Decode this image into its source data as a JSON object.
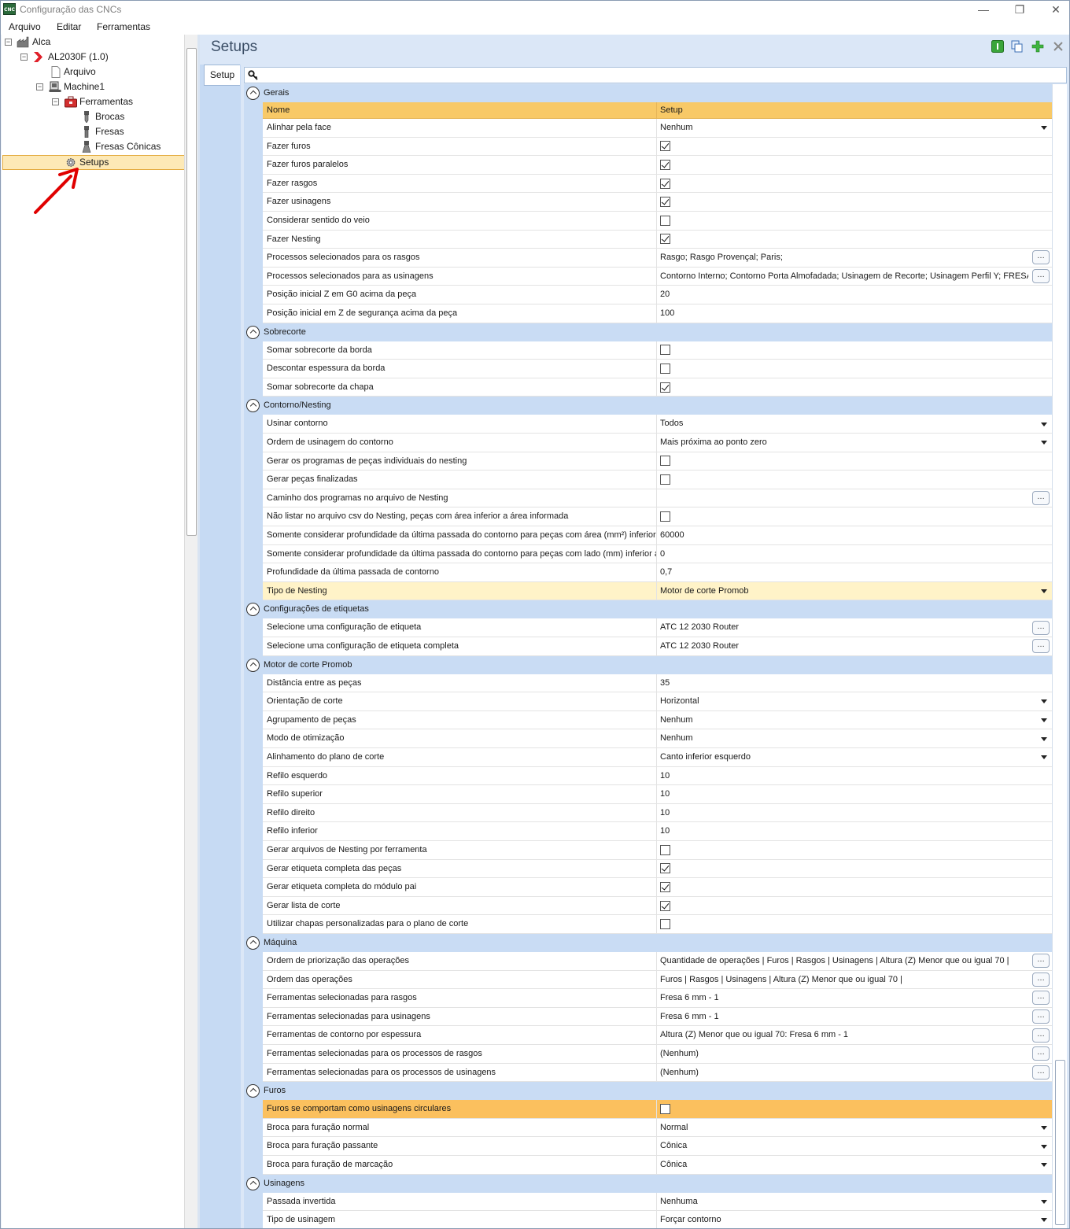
{
  "window": {
    "title": "Configuração das CNCs",
    "app_icon_text": "CNC",
    "minimize": "—",
    "restore": "❐",
    "close": "✕"
  },
  "menu": [
    "Arquivo",
    "Editar",
    "Ferramentas"
  ],
  "tree": {
    "root": "Alca",
    "machine_file": "AL2030F (1.0)",
    "arquivo": "Arquivo",
    "machine": "Machine1",
    "ferramentas": "Ferramentas",
    "brocas": "Brocas",
    "fresas": "Fresas",
    "fresas_conicas": "Fresas Cônicas",
    "setups": "Setups"
  },
  "page": {
    "title": "Setups",
    "tab": "Setup",
    "search_icon": "key-search-icon"
  },
  "grid": {
    "header": {
      "name": "Nome",
      "value": "Setup"
    },
    "rows": [
      {
        "kind": "group",
        "label": "Gerais"
      },
      {
        "kind": "header"
      },
      {
        "kind": "prop",
        "name": "Alinhar pela face",
        "type": "dropdown",
        "value": "Nenhum"
      },
      {
        "kind": "prop",
        "name": "Fazer furos",
        "type": "check",
        "checked": true
      },
      {
        "kind": "prop",
        "name": "Fazer furos paralelos",
        "type": "check",
        "checked": true
      },
      {
        "kind": "prop",
        "name": "Fazer rasgos",
        "type": "check",
        "checked": true
      },
      {
        "kind": "prop",
        "name": "Fazer usinagens",
        "type": "check",
        "checked": true
      },
      {
        "kind": "prop",
        "name": "Considerar sentido do veio",
        "type": "check",
        "checked": false
      },
      {
        "kind": "prop",
        "name": "Fazer Nesting",
        "type": "check",
        "checked": true
      },
      {
        "kind": "prop",
        "name": "Processos selecionados para os rasgos",
        "type": "ellipsis",
        "value": "Rasgo; Rasgo Provençal; Paris;"
      },
      {
        "kind": "prop",
        "name": "Processos selecionados para as usinagens",
        "type": "ellipsis",
        "value": "Contorno Interno; Contorno Porta Almofadada; Usinagem de Recorte; Usinagem Perfil Y; FRESADO"
      },
      {
        "kind": "prop",
        "name": "Posição inicial Z em G0 acima da peça",
        "type": "text",
        "value": "20"
      },
      {
        "kind": "prop",
        "name": "Posição inicial em Z de segurança acima da peça",
        "type": "text",
        "value": "100"
      },
      {
        "kind": "group",
        "label": "Sobrecorte"
      },
      {
        "kind": "prop",
        "name": "Somar sobrecorte da borda",
        "type": "check",
        "checked": false
      },
      {
        "kind": "prop",
        "name": "Descontar espessura da borda",
        "type": "check",
        "checked": false
      },
      {
        "kind": "prop",
        "name": "Somar sobrecorte da chapa",
        "type": "check",
        "checked": true
      },
      {
        "kind": "group",
        "label": "Contorno/Nesting"
      },
      {
        "kind": "prop",
        "name": "Usinar contorno",
        "type": "dropdown",
        "value": "Todos"
      },
      {
        "kind": "prop",
        "name": "Ordem de usinagem do contorno",
        "type": "dropdown",
        "value": "Mais próxima ao ponto zero"
      },
      {
        "kind": "prop",
        "name": "Gerar os programas de peças individuais do nesting",
        "type": "check",
        "checked": false
      },
      {
        "kind": "prop",
        "name": "Gerar peças finalizadas",
        "type": "check",
        "checked": false
      },
      {
        "kind": "prop",
        "name": "Caminho dos programas no arquivo de Nesting",
        "type": "ellipsis",
        "value": ""
      },
      {
        "kind": "prop",
        "name": "Não listar no arquivo csv do Nesting, peças com área inferior a área informada",
        "type": "check",
        "checked": false
      },
      {
        "kind": "prop",
        "name": "Somente considerar profundidade da última passada do contorno para peças com área (mm²) inferior",
        "type": "text",
        "value": "60000"
      },
      {
        "kind": "prop",
        "name": "Somente considerar profundidade da última passada do contorno para peças com lado (mm) inferior a",
        "type": "text",
        "value": "0"
      },
      {
        "kind": "prop",
        "name": "Profundidade da última passada de contorno",
        "type": "text",
        "value": "0,7"
      },
      {
        "kind": "prop",
        "name": "Tipo de Nesting",
        "type": "dropdown",
        "value": "Motor de corte Promob",
        "state": "sel"
      },
      {
        "kind": "group",
        "label": "Configurações de etiquetas"
      },
      {
        "kind": "prop",
        "name": "Selecione uma configuração de etiqueta",
        "type": "ellipsis",
        "value": "ATC 12 2030 Router"
      },
      {
        "kind": "prop",
        "name": "Selecione uma configuração de etiqueta completa",
        "type": "ellipsis",
        "value": "ATC 12 2030 Router"
      },
      {
        "kind": "group",
        "label": "Motor de corte Promob"
      },
      {
        "kind": "prop",
        "name": "Distância entre as peças",
        "type": "text",
        "value": "35"
      },
      {
        "kind": "prop",
        "name": "Orientação de corte",
        "type": "dropdown",
        "value": "Horizontal"
      },
      {
        "kind": "prop",
        "name": "Agrupamento de peças",
        "type": "dropdown",
        "value": "Nenhum"
      },
      {
        "kind": "prop",
        "name": "Modo de otimização",
        "type": "dropdown",
        "value": "Nenhum"
      },
      {
        "kind": "prop",
        "name": "Alinhamento do plano de corte",
        "type": "dropdown",
        "value": "Canto inferior esquerdo"
      },
      {
        "kind": "prop",
        "name": "Refilo esquerdo",
        "type": "text",
        "value": "10"
      },
      {
        "kind": "prop",
        "name": "Refilo superior",
        "type": "text",
        "value": "10"
      },
      {
        "kind": "prop",
        "name": "Refilo direito",
        "type": "text",
        "value": "10"
      },
      {
        "kind": "prop",
        "name": "Refilo inferior",
        "type": "text",
        "value": "10"
      },
      {
        "kind": "prop",
        "name": "Gerar arquivos de Nesting por ferramenta",
        "type": "check",
        "checked": false
      },
      {
        "kind": "prop",
        "name": "Gerar etiqueta completa das peças",
        "type": "check",
        "checked": true
      },
      {
        "kind": "prop",
        "name": "Gerar etiqueta completa do módulo pai",
        "type": "check",
        "checked": true
      },
      {
        "kind": "prop",
        "name": "Gerar lista de corte",
        "type": "check",
        "checked": true
      },
      {
        "kind": "prop",
        "name": "Utilizar chapas personalizadas para o plano de corte",
        "type": "check",
        "checked": false
      },
      {
        "kind": "group",
        "label": "Máquina"
      },
      {
        "kind": "prop",
        "name": "Ordem de priorização das operações",
        "type": "ellipsis",
        "value": "Quantidade de operações | Furos | Rasgos | Usinagens | Altura (Z) Menor que ou igual 70 |"
      },
      {
        "kind": "prop",
        "name": "Ordem das operações",
        "type": "ellipsis",
        "value": "Furos | Rasgos | Usinagens | Altura (Z) Menor que ou igual 70 |"
      },
      {
        "kind": "prop",
        "name": "Ferramentas selecionadas para rasgos",
        "type": "ellipsis",
        "value": "Fresa 6 mm - 1"
      },
      {
        "kind": "prop",
        "name": "Ferramentas selecionadas para usinagens",
        "type": "ellipsis",
        "value": "Fresa 6 mm - 1"
      },
      {
        "kind": "prop",
        "name": "Ferramentas de contorno por espessura",
        "type": "ellipsis",
        "value": "Altura (Z) Menor que ou igual 70: Fresa 6 mm - 1"
      },
      {
        "kind": "prop",
        "name": "Ferramentas selecionadas para os processos de rasgos",
        "type": "ellipsis",
        "value": "(Nenhum)"
      },
      {
        "kind": "prop",
        "name": "Ferramentas selecionadas para os processos de usinagens",
        "type": "ellipsis",
        "value": "(Nenhum)"
      },
      {
        "kind": "group",
        "label": "Furos"
      },
      {
        "kind": "prop",
        "name": "Furos se comportam como usinagens circulares",
        "type": "check",
        "checked": false,
        "state": "hl"
      },
      {
        "kind": "prop",
        "name": "Broca para furação normal",
        "type": "dropdown",
        "value": "Normal"
      },
      {
        "kind": "prop",
        "name": "Broca para furação passante",
        "type": "dropdown",
        "value": "Cônica"
      },
      {
        "kind": "prop",
        "name": "Broca para furação de marcação",
        "type": "dropdown",
        "value": "Cônica"
      },
      {
        "kind": "group",
        "label": "Usinagens"
      },
      {
        "kind": "prop",
        "name": "Passada invertida",
        "type": "dropdown",
        "value": "Nenhuma"
      },
      {
        "kind": "prop",
        "name": "Tipo de usinagem",
        "type": "dropdown",
        "value": "Forçar contorno"
      }
    ]
  },
  "colors": {
    "accent_header": "#f8c967",
    "selected_row": "#fff3c8",
    "highlight_row": "#fbc05e",
    "group_band": "#c9dcf4",
    "annotation_arrow": "#e00000"
  }
}
